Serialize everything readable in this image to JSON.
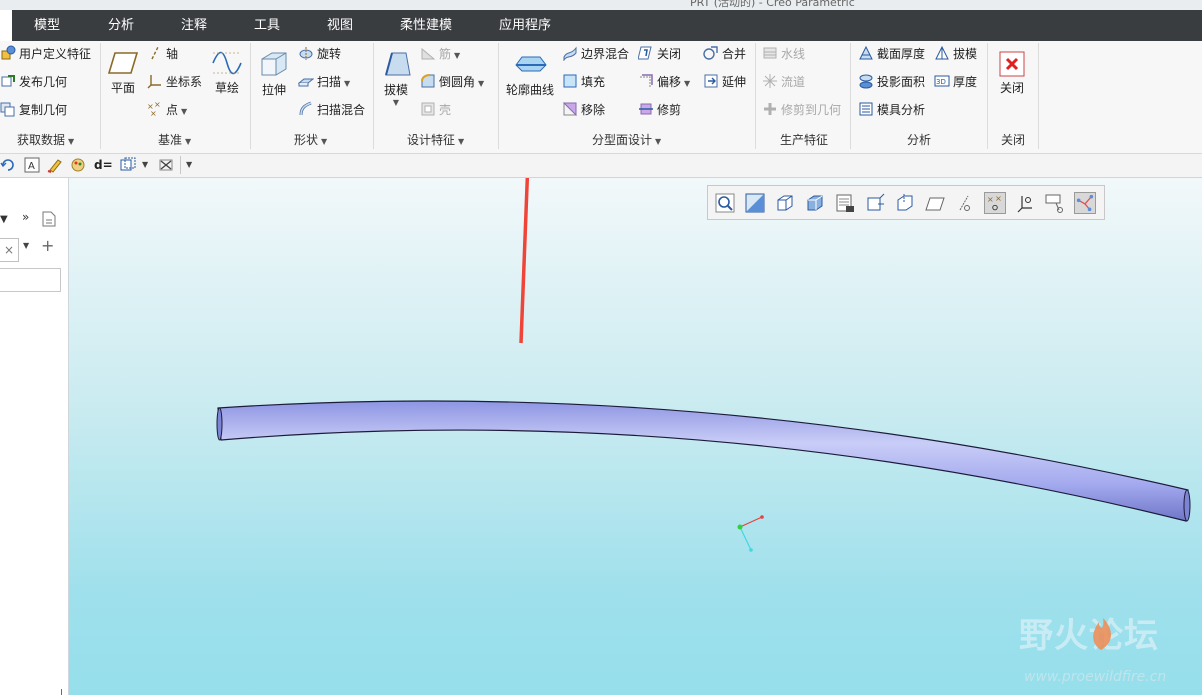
{
  "window": {
    "title": "PRT (活动的) - Creo Parametric"
  },
  "menu_tabs": [
    "模型",
    "分析",
    "注释",
    "工具",
    "视图",
    "柔性建模",
    "应用程序"
  ],
  "ribbon": {
    "get_data": {
      "label": "获取数据",
      "items": [
        "用户定义特征",
        "发布几何",
        "复制几何"
      ]
    },
    "datum": {
      "label": "基准",
      "plane": "平面",
      "axis": "轴",
      "csys": "坐标系",
      "point": "点",
      "sketch": "草绘"
    },
    "shapes": {
      "label": "形状",
      "extrude": "拉伸",
      "revolve": "旋转",
      "sweep": "扫描",
      "swept_blend": "扫描混合"
    },
    "design_features": {
      "label": "设计特征",
      "draft": "拔模",
      "rib": "筋",
      "round": "倒圆角",
      "shell": "壳"
    },
    "parting_surface": {
      "label": "分型面设计",
      "silhouette_curve": "轮廓曲线",
      "boundary_blend": "边界混合",
      "fill": "填充",
      "remove": "移除",
      "close": "关闭",
      "offset": "偏移",
      "trim": "修剪",
      "merge": "合并",
      "extend": "延伸"
    },
    "production": {
      "label": "生产特征",
      "water_line": "水线",
      "runner": "流道",
      "trim_to_geometry": "修剪到几何"
    },
    "analysis": {
      "label": "分析",
      "section_thickness": "截面厚度",
      "draft_check": "拔模",
      "projected_area": "投影面积",
      "thickness": "厚度",
      "mold_analysis": "模具分析"
    },
    "close_group": {
      "label": "关闭",
      "close": "关闭"
    }
  },
  "quickbar": {
    "d_label": "d="
  },
  "watermark": {
    "logo": "野火论坛",
    "url": "www.proewildfire.cn"
  },
  "colors": {
    "menubar": "#3a3d40",
    "tube": "#a9aff0",
    "arrow": "#f04438",
    "close_x": "#e02020"
  }
}
